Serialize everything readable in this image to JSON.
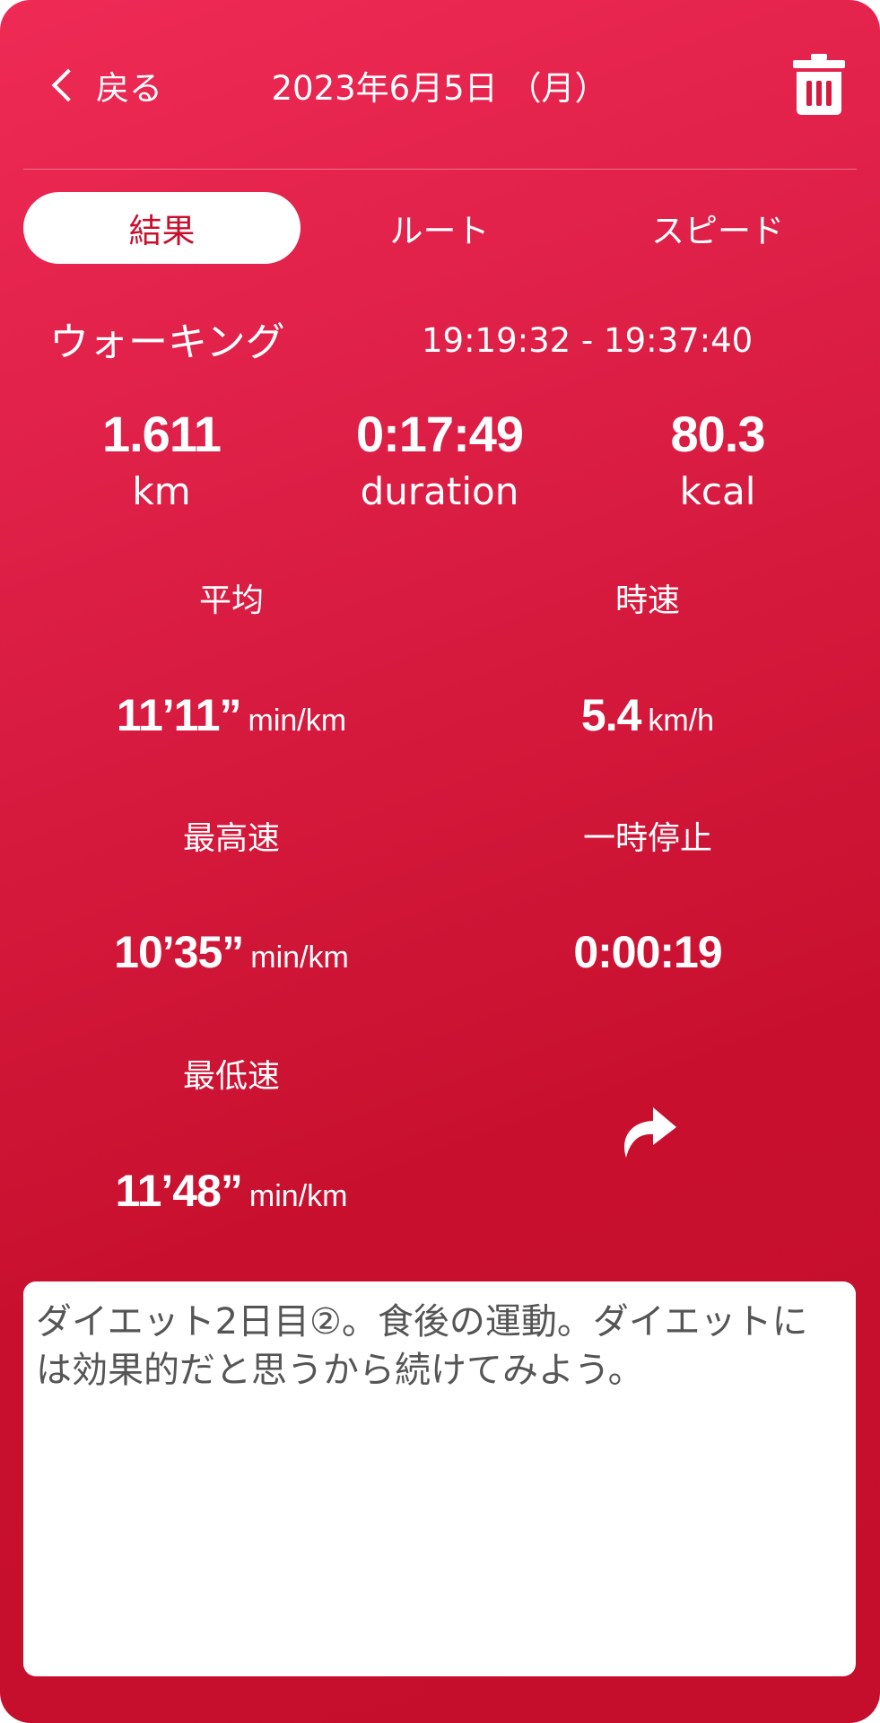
{
  "header": {
    "back_label": "戻る",
    "date_title": "2023年6月5日 （月）"
  },
  "tabs": [
    {
      "label": "結果",
      "active": true
    },
    {
      "label": "ルート",
      "active": false
    },
    {
      "label": "スピード",
      "active": false
    }
  ],
  "activity": {
    "type": "ウォーキング",
    "time_range": "19:19:32 - 19:37:40"
  },
  "summary": {
    "distance": {
      "value": "1.611",
      "unit": "km"
    },
    "duration": {
      "value": "0:17:49",
      "unit": "duration"
    },
    "calories": {
      "value": "80.3",
      "unit": "kcal"
    }
  },
  "details": {
    "average_pace": {
      "label": "平均",
      "value": "11’11”",
      "unit": "min/km"
    },
    "speed": {
      "label": "時速",
      "value": "5.4",
      "unit": "km/h"
    },
    "fastest_pace": {
      "label": "最高速",
      "value": "10’35”",
      "unit": "min/km"
    },
    "paused": {
      "label": "一時停止",
      "value": "0:00:19"
    },
    "slowest_pace": {
      "label": "最低速",
      "value": "11’48”",
      "unit": "min/km"
    }
  },
  "memo": {
    "text": "ダイエット2日目②。食後の運動。ダイエットには効果的だと思うから続けてみよう。"
  },
  "icons": {
    "back": "chevron-left-icon",
    "delete": "trash-icon",
    "share": "share-arrow-icon"
  },
  "colors": {
    "background": "#c8102e",
    "accent_light": "#ee2a55",
    "tab_active_text": "#c8102e",
    "memo_text": "#555555"
  }
}
